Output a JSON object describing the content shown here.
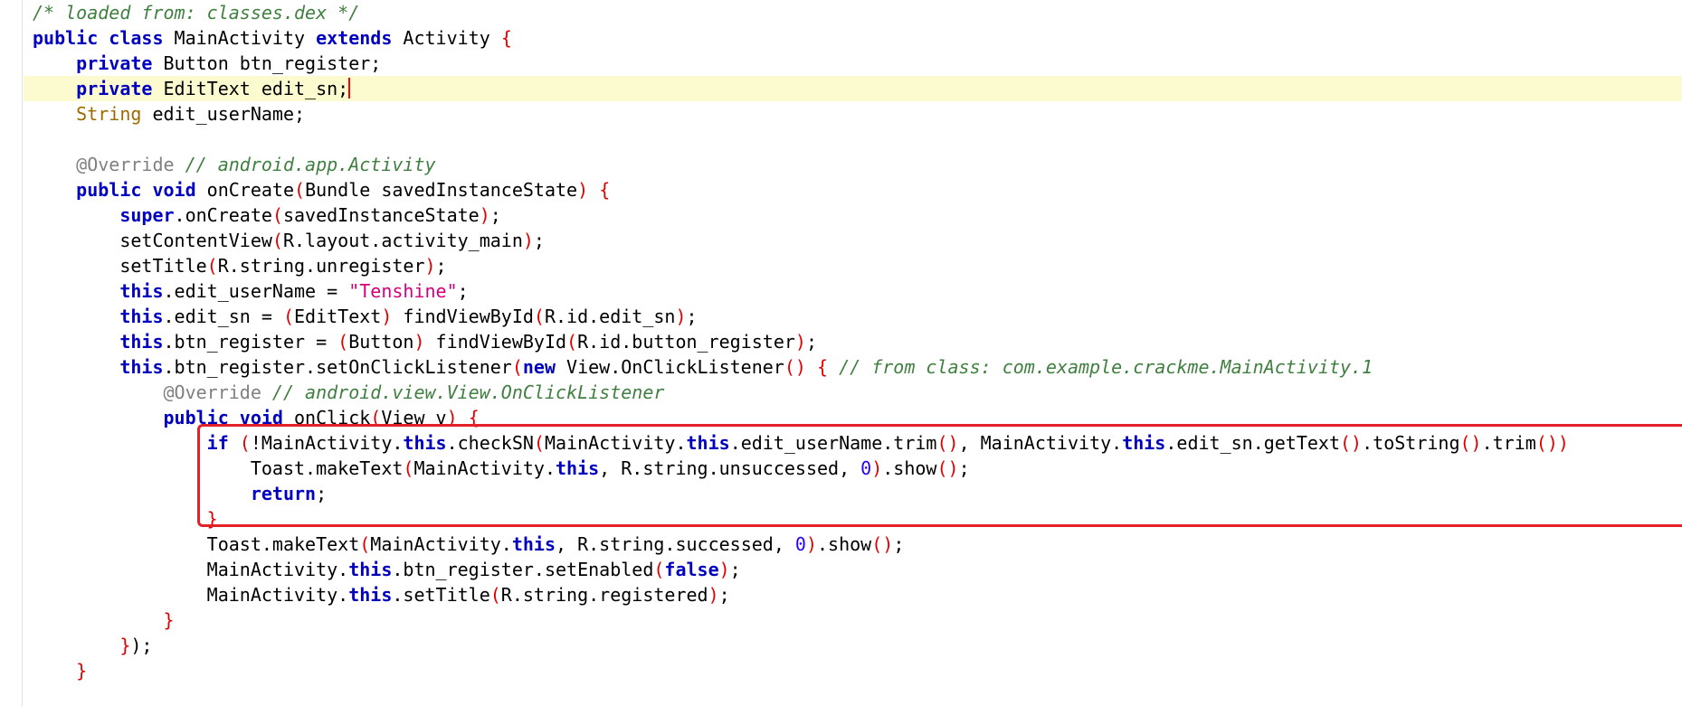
{
  "editor": {
    "annotation_color": "#e52128",
    "current_line_color": "#fcfbcf",
    "lines": [
      [
        {
          "t": "/* loaded from: classes.dex */",
          "c": "cm"
        }
      ],
      [
        {
          "t": "public",
          "c": "kw"
        },
        {
          "t": " "
        },
        {
          "t": "class",
          "c": "kw"
        },
        {
          "t": " MainActivity "
        },
        {
          "t": "extends",
          "c": "kw"
        },
        {
          "t": " Activity "
        },
        {
          "t": "{",
          "c": "br"
        }
      ],
      [
        {
          "t": "    "
        },
        {
          "t": "private",
          "c": "kw"
        },
        {
          "t": " Button btn_register;"
        }
      ],
      [
        {
          "t": "    "
        },
        {
          "t": "private",
          "c": "kw"
        },
        {
          "t": " EditText edit_sn;"
        }
      ],
      [
        {
          "t": "    "
        },
        {
          "t": "String",
          "c": "type"
        },
        {
          "t": " edit_userName;"
        }
      ],
      [],
      [
        {
          "t": "    "
        },
        {
          "t": "@Override",
          "c": "ann"
        },
        {
          "t": " "
        },
        {
          "t": "// android.app.Activity",
          "c": "cm"
        }
      ],
      [
        {
          "t": "    "
        },
        {
          "t": "public",
          "c": "kw"
        },
        {
          "t": " "
        },
        {
          "t": "void",
          "c": "kw"
        },
        {
          "t": " onCreate"
        },
        {
          "t": "(",
          "c": "br"
        },
        {
          "t": "Bundle savedInstanceState"
        },
        {
          "t": ")",
          "c": "br"
        },
        {
          "t": " "
        },
        {
          "t": "{",
          "c": "br"
        }
      ],
      [
        {
          "t": "        "
        },
        {
          "t": "super",
          "c": "kw"
        },
        {
          "t": ".onCreate"
        },
        {
          "t": "(",
          "c": "br"
        },
        {
          "t": "savedInstanceState"
        },
        {
          "t": ")",
          "c": "br"
        },
        {
          "t": ";"
        }
      ],
      [
        {
          "t": "        setContentView"
        },
        {
          "t": "(",
          "c": "br"
        },
        {
          "t": "R.layout.activity_main"
        },
        {
          "t": ")",
          "c": "br"
        },
        {
          "t": ";"
        }
      ],
      [
        {
          "t": "        setTitle"
        },
        {
          "t": "(",
          "c": "br"
        },
        {
          "t": "R.string.unregister"
        },
        {
          "t": ")",
          "c": "br"
        },
        {
          "t": ";"
        }
      ],
      [
        {
          "t": "        "
        },
        {
          "t": "this",
          "c": "kw"
        },
        {
          "t": ".edit_userName = "
        },
        {
          "t": "\"Tenshine\"",
          "c": "str"
        },
        {
          "t": ";"
        }
      ],
      [
        {
          "t": "        "
        },
        {
          "t": "this",
          "c": "kw"
        },
        {
          "t": ".edit_sn = "
        },
        {
          "t": "(",
          "c": "br"
        },
        {
          "t": "EditText"
        },
        {
          "t": ")",
          "c": "br"
        },
        {
          "t": " findViewById"
        },
        {
          "t": "(",
          "c": "br"
        },
        {
          "t": "R.id.edit_sn"
        },
        {
          "t": ")",
          "c": "br"
        },
        {
          "t": ";"
        }
      ],
      [
        {
          "t": "        "
        },
        {
          "t": "this",
          "c": "kw"
        },
        {
          "t": ".btn_register = "
        },
        {
          "t": "(",
          "c": "br"
        },
        {
          "t": "Button"
        },
        {
          "t": ")",
          "c": "br"
        },
        {
          "t": " findViewById"
        },
        {
          "t": "(",
          "c": "br"
        },
        {
          "t": "R.id.button_register"
        },
        {
          "t": ")",
          "c": "br"
        },
        {
          "t": ";"
        }
      ],
      [
        {
          "t": "        "
        },
        {
          "t": "this",
          "c": "kw"
        },
        {
          "t": ".btn_register.setOnClickListener"
        },
        {
          "t": "(",
          "c": "br"
        },
        {
          "t": "new",
          "c": "kw"
        },
        {
          "t": " View.OnClickListener"
        },
        {
          "t": "()",
          "c": "br"
        },
        {
          "t": " "
        },
        {
          "t": "{",
          "c": "br"
        },
        {
          "t": " "
        },
        {
          "t": "// from class: com.example.crackme.MainActivity.1",
          "c": "cm"
        }
      ],
      [
        {
          "t": "            "
        },
        {
          "t": "@Override",
          "c": "ann"
        },
        {
          "t": " "
        },
        {
          "t": "// android.view.View.OnClickListener",
          "c": "cm"
        }
      ],
      [
        {
          "t": "            "
        },
        {
          "t": "public",
          "c": "kw"
        },
        {
          "t": " "
        },
        {
          "t": "void",
          "c": "kw"
        },
        {
          "t": " onClick"
        },
        {
          "t": "(",
          "c": "br"
        },
        {
          "t": "View v"
        },
        {
          "t": ")",
          "c": "br"
        },
        {
          "t": " "
        },
        {
          "t": "{",
          "c": "br"
        }
      ],
      [
        {
          "t": "                "
        },
        {
          "t": "if",
          "c": "kw"
        },
        {
          "t": " "
        },
        {
          "t": "(",
          "c": "br"
        },
        {
          "t": "!MainActivity."
        },
        {
          "t": "this",
          "c": "kw"
        },
        {
          "t": ".checkSN"
        },
        {
          "t": "(",
          "c": "br"
        },
        {
          "t": "MainActivity."
        },
        {
          "t": "this",
          "c": "kw"
        },
        {
          "t": ".edit_userName.trim"
        },
        {
          "t": "()",
          "c": "br"
        },
        {
          "t": ", MainActivity."
        },
        {
          "t": "this",
          "c": "kw"
        },
        {
          "t": ".edit_sn.getText"
        },
        {
          "t": "()",
          "c": "br"
        },
        {
          "t": ".toString"
        },
        {
          "t": "()",
          "c": "br"
        },
        {
          "t": ".trim"
        },
        {
          "t": "()",
          "c": "br"
        },
        {
          "t": ")",
          "c": "br"
        }
      ],
      [
        {
          "t": "                    Toast.makeText"
        },
        {
          "t": "(",
          "c": "br"
        },
        {
          "t": "MainActivity."
        },
        {
          "t": "this",
          "c": "kw"
        },
        {
          "t": ", R.string.unsuccessed, "
        },
        {
          "t": "0",
          "c": "num"
        },
        {
          "t": ")",
          "c": "br"
        },
        {
          "t": ".show"
        },
        {
          "t": "()",
          "c": "br"
        },
        {
          "t": ";"
        }
      ],
      [
        {
          "t": "                    "
        },
        {
          "t": "return",
          "c": "kw"
        },
        {
          "t": ";"
        }
      ],
      [
        {
          "t": "                "
        },
        {
          "t": "}",
          "c": "br"
        }
      ],
      [
        {
          "t": "                Toast.makeText"
        },
        {
          "t": "(",
          "c": "br"
        },
        {
          "t": "MainActivity."
        },
        {
          "t": "this",
          "c": "kw"
        },
        {
          "t": ", R.string.successed, "
        },
        {
          "t": "0",
          "c": "num"
        },
        {
          "t": ")",
          "c": "br"
        },
        {
          "t": ".show"
        },
        {
          "t": "()",
          "c": "br"
        },
        {
          "t": ";"
        }
      ],
      [
        {
          "t": "                MainActivity."
        },
        {
          "t": "this",
          "c": "kw"
        },
        {
          "t": ".btn_register.setEnabled"
        },
        {
          "t": "(",
          "c": "br"
        },
        {
          "t": "false",
          "c": "kw"
        },
        {
          "t": ")",
          "c": "br"
        },
        {
          "t": ";"
        }
      ],
      [
        {
          "t": "                MainActivity."
        },
        {
          "t": "this",
          "c": "kw"
        },
        {
          "t": ".setTitle"
        },
        {
          "t": "(",
          "c": "br"
        },
        {
          "t": "R.string.registered"
        },
        {
          "t": ")",
          "c": "br"
        },
        {
          "t": ";"
        }
      ],
      [
        {
          "t": "            "
        },
        {
          "t": "}",
          "c": "br"
        }
      ],
      [
        {
          "t": "        "
        },
        {
          "t": "}",
          "c": "br"
        },
        {
          "t": ");"
        }
      ],
      [
        {
          "t": "    "
        },
        {
          "t": "}",
          "c": "br"
        }
      ]
    ]
  }
}
